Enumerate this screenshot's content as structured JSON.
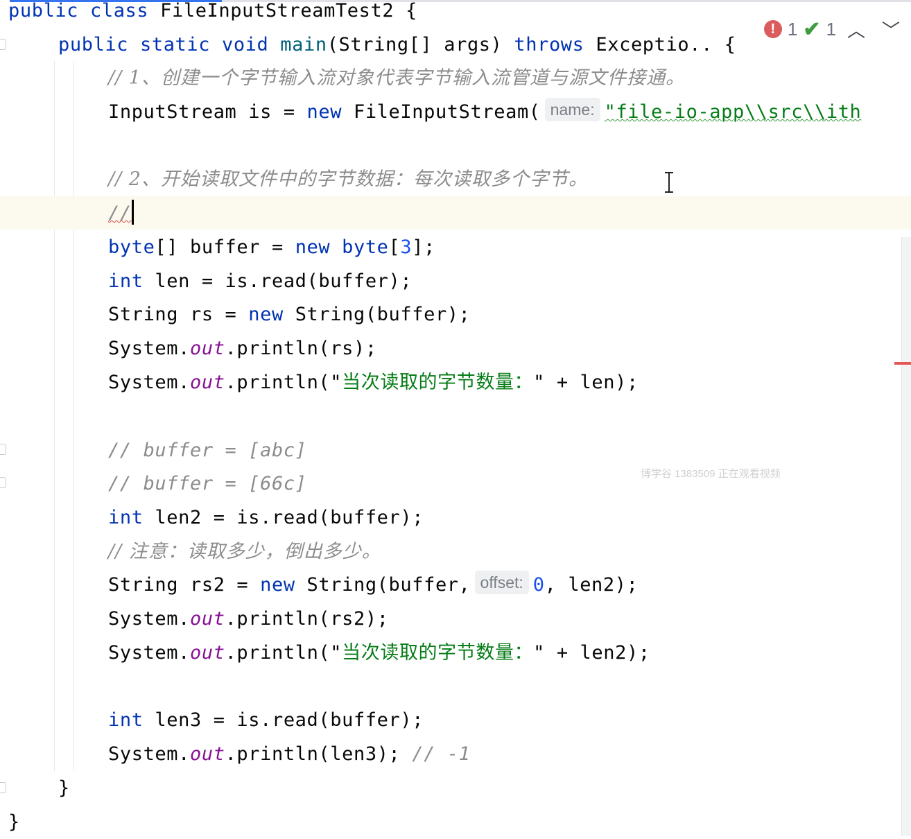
{
  "editor": {
    "lines": {
      "l1": {
        "kw": "public class ",
        "rest": "FileInputStreamTest2 {"
      },
      "l2": {
        "kw": "public static void ",
        "method": "main",
        "mid": "(String[] args) ",
        "throws": "throws ",
        "rest": "Exceptio.. {"
      },
      "l3": {
        "comment": "// 1、创建一个字节输入流对象代表字节输入流管道与源文件接通。"
      },
      "l4": {
        "pre": "InputStream is = ",
        "kw": "new ",
        "call": "FileInputStream(",
        "hint": "name:",
        "str": "\"file-io-app\\\\src\\\\ith"
      },
      "l6": {
        "comment": "// 2、开始读取文件中的字节数据：每次读取多个字节。"
      },
      "l7": {
        "comment": "//"
      },
      "l8": {
        "kw1": "byte",
        "a": "[] buffer = ",
        "kw2": "new ",
        "kw3": "byte",
        "b": "[",
        "num": "3",
        "c": "];"
      },
      "l9": {
        "kw": "int ",
        "rest": "len = is.read(buffer);"
      },
      "l10": {
        "pre": "String rs = ",
        "kw": "new ",
        "rest": "String(buffer);"
      },
      "l11": {
        "a": "System.",
        "field": "out",
        "b": ".println(rs);"
      },
      "l12": {
        "a": "System.",
        "field": "out",
        "b": ".println(\"",
        "str": "当次读取的字节数量：",
        "c": "\" + len);"
      },
      "l14": {
        "comment": "// buffer = [abc]"
      },
      "l15": {
        "comment": "// buffer = [66c]"
      },
      "l16": {
        "kw": "int ",
        "rest": "len2 = is.read(buffer);"
      },
      "l17": {
        "comment": "// 注意：读取多少，倒出多少。"
      },
      "l18": {
        "pre": "String rs2 = ",
        "kw": "new ",
        "call": "String(buffer,",
        "hint": "offset:",
        "num": "0",
        "rest": ", len2);"
      },
      "l19": {
        "a": "System.",
        "field": "out",
        "b": ".println(rs2);"
      },
      "l20": {
        "a": "System.",
        "field": "out",
        "b": ".println(\"",
        "str": "当次读取的字节数量：",
        "c": "\" + len2);"
      },
      "l22": {
        "kw": "int ",
        "rest": "len3 = is.read(buffer);"
      },
      "l23": {
        "a": "System.",
        "field": "out",
        "b": ".println(len3); ",
        "comment": "// -1"
      },
      "l24": {
        "text": "}"
      },
      "l25": {
        "text": "}"
      }
    }
  },
  "inspections": {
    "error_count": "1",
    "warning_count": "1",
    "error_icon": "error-icon",
    "warning_icon": "check-icon",
    "error_color": "#db5c5c",
    "check_color": "#3e9b3e"
  },
  "watermark": "博学谷 1383509 正在观看视频",
  "colors": {
    "keyword": "#0033b3",
    "string": "#067d17",
    "number": "#1750eb",
    "comment": "#8c8c8c",
    "field": "#871094"
  }
}
